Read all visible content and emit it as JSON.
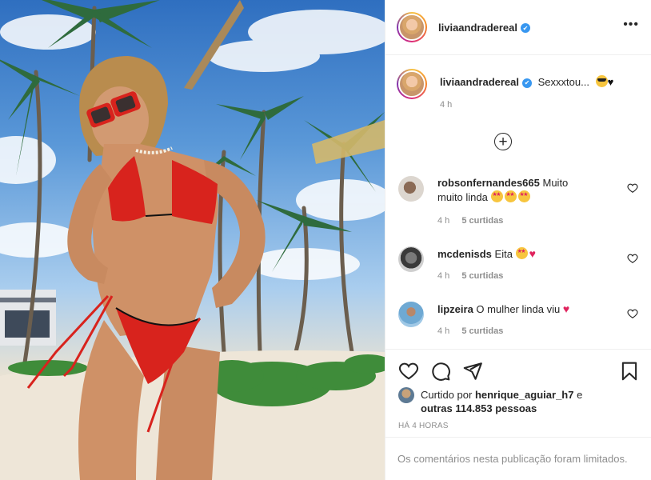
{
  "post": {
    "author": "liviaandradereal",
    "verified": true,
    "caption": "Sexxxtou...",
    "caption_emoji": [
      "smiling-face-with-sunglasses",
      "black-heart"
    ],
    "caption_time": "4 h",
    "more_label": "•••",
    "load_more_label": "+"
  },
  "comments": [
    {
      "username": "robsonfernandes665",
      "text_line1": "Muito",
      "text_line2": "muito linda",
      "emoji": [
        "star-struck",
        "star-struck",
        "star-struck"
      ],
      "time": "4 h",
      "likes": "5 curtidas"
    },
    {
      "username": "mcdenisds",
      "text_line1": "Eita",
      "emoji": [
        "star-struck",
        "red-heart"
      ],
      "time": "4 h",
      "likes": "5 curtidas"
    },
    {
      "username": "lipzeira",
      "text_line1": "O mulher linda viu",
      "emoji": [
        "red-heart"
      ],
      "time": "4 h",
      "likes": "5 curtidas"
    }
  ],
  "likes": {
    "prefix": "Curtido por",
    "user": "henrique_aguiar_h7",
    "connector": "e",
    "others": "outras 114.853 pessoas"
  },
  "age": "HÁ 4 HORAS",
  "comments_limited": "Os comentários nesta publicação foram limitados.",
  "icons": {
    "like": "heart-outline-icon",
    "comment": "comment-bubble-icon",
    "share": "paper-plane-icon",
    "save": "bookmark-icon",
    "verified": "verified-badge-icon"
  },
  "colors": {
    "text": "#262626",
    "secondary": "#8e8e8e",
    "border": "#efefef",
    "verified": "#3897f0",
    "heart_red": "#e0245e",
    "bikini_red": "#d8231d"
  }
}
